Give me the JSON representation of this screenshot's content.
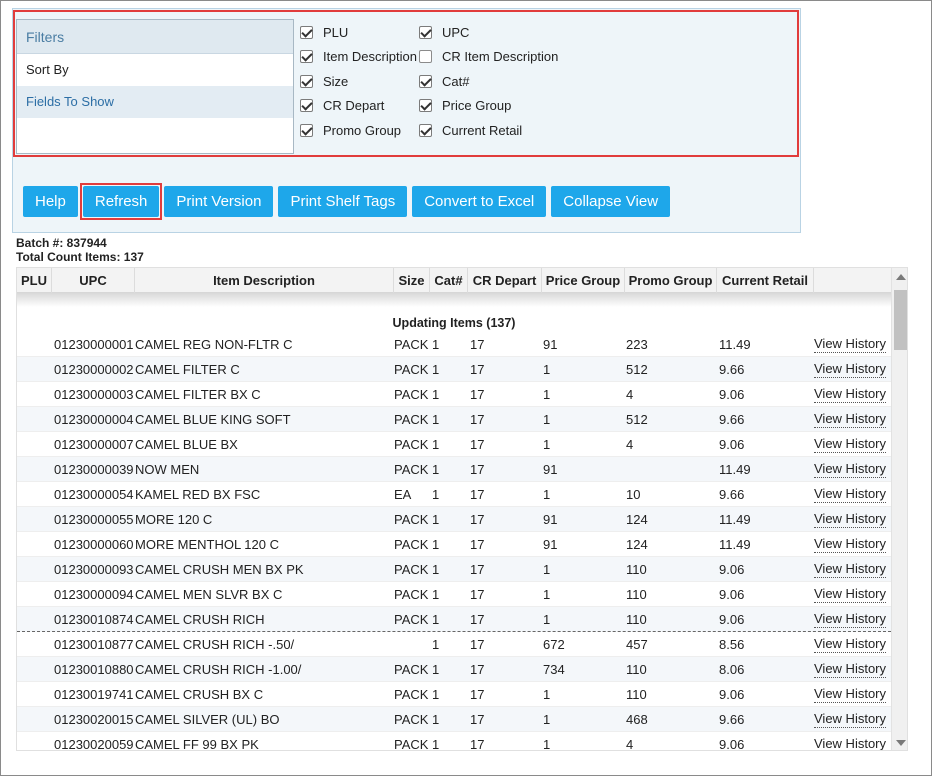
{
  "filters": {
    "items": [
      {
        "label": "Filters"
      },
      {
        "label": "Sort By"
      },
      {
        "label": "Fields To Show"
      }
    ]
  },
  "fields": {
    "left": [
      {
        "label": "PLU",
        "checked": true
      },
      {
        "label": "Item Description",
        "checked": true
      },
      {
        "label": "Size",
        "checked": true
      },
      {
        "label": "CR Depart",
        "checked": true
      },
      {
        "label": "Promo Group",
        "checked": true
      }
    ],
    "right": [
      {
        "label": "UPC",
        "checked": true
      },
      {
        "label": "CR Item Description",
        "checked": false
      },
      {
        "label": "Cat#",
        "checked": true
      },
      {
        "label": "Price Group",
        "checked": true
      },
      {
        "label": "Current Retail",
        "checked": true
      }
    ]
  },
  "buttons": {
    "help": "Help",
    "refresh": "Refresh",
    "print_version": "Print Version",
    "print_shelf_tags": "Print Shelf Tags",
    "convert_excel": "Convert to Excel",
    "collapse_view": "Collapse View"
  },
  "info": {
    "batch": "Batch #: 837944",
    "total": "Total Count Items: 137"
  },
  "table": {
    "headers": [
      "PLU",
      "UPC",
      "Item Description",
      "Size",
      "Cat#",
      "CR Depart",
      "Price Group",
      "Promo Group",
      "Current Retail"
    ],
    "group_title": "Updating Items (137)",
    "view_history": "View History",
    "rows": [
      {
        "upc": "01230000001",
        "desc": "CAMEL REG NON-FLTR C",
        "size": "PACK",
        "cat": "1",
        "dep": "17",
        "price": "91",
        "promo": "223",
        "retail": "11.49"
      },
      {
        "upc": "01230000002",
        "desc": "CAMEL FILTER C",
        "size": "PACK",
        "cat": "1",
        "dep": "17",
        "price": "1",
        "promo": "512",
        "retail": "9.66"
      },
      {
        "upc": "01230000003",
        "desc": "CAMEL FILTER BX C",
        "size": "PACK",
        "cat": "1",
        "dep": "17",
        "price": "1",
        "promo": "4",
        "retail": "9.06"
      },
      {
        "upc": "01230000004",
        "desc": "CAMEL BLUE KING SOFT",
        "size": "PACK",
        "cat": "1",
        "dep": "17",
        "price": "1",
        "promo": "512",
        "retail": "9.66"
      },
      {
        "upc": "01230000007",
        "desc": "CAMEL BLUE BX",
        "size": "PACK",
        "cat": "1",
        "dep": "17",
        "price": "1",
        "promo": "4",
        "retail": "9.06"
      },
      {
        "upc": "01230000039",
        "desc": "NOW MEN",
        "size": "PACK",
        "cat": "1",
        "dep": "17",
        "price": "91",
        "promo": "",
        "retail": "11.49"
      },
      {
        "upc": "01230000054",
        "desc": "KAMEL RED BX FSC",
        "size": "EA",
        "cat": "1",
        "dep": "17",
        "price": "1",
        "promo": "10",
        "retail": "9.66"
      },
      {
        "upc": "01230000055",
        "desc": "MORE 120 C",
        "size": "PACK",
        "cat": "1",
        "dep": "17",
        "price": "91",
        "promo": "124",
        "retail": "11.49"
      },
      {
        "upc": "01230000060",
        "desc": "MORE MENTHOL 120 C",
        "size": "PACK",
        "cat": "1",
        "dep": "17",
        "price": "91",
        "promo": "124",
        "retail": "11.49"
      },
      {
        "upc": "01230000093",
        "desc": "CAMEL CRUSH MEN BX PK",
        "size": "PACK",
        "cat": "1",
        "dep": "17",
        "price": "1",
        "promo": "110",
        "retail": "9.06"
      },
      {
        "upc": "01230000094",
        "desc": "CAMEL MEN SLVR BX C",
        "size": "PACK",
        "cat": "1",
        "dep": "17",
        "price": "1",
        "promo": "110",
        "retail": "9.06"
      },
      {
        "upc": "01230010874",
        "desc": "CAMEL CRUSH RICH",
        "size": "PACK",
        "cat": "1",
        "dep": "17",
        "price": "1",
        "promo": "110",
        "retail": "9.06"
      },
      {
        "upc": "01230010877",
        "desc": "CAMEL CRUSH RICH -.50/",
        "size": "",
        "cat": "1",
        "dep": "17",
        "price": "672",
        "promo": "457",
        "retail": "8.56"
      },
      {
        "upc": "01230010880",
        "desc": "CAMEL CRUSH RICH -1.00/",
        "size": "PACK",
        "cat": "1",
        "dep": "17",
        "price": "734",
        "promo": "110",
        "retail": "8.06"
      },
      {
        "upc": "01230019741",
        "desc": "CAMEL CRUSH BX C",
        "size": "PACK",
        "cat": "1",
        "dep": "17",
        "price": "1",
        "promo": "110",
        "retail": "9.06"
      },
      {
        "upc": "01230020015",
        "desc": "CAMEL SILVER (UL) BO",
        "size": "PACK",
        "cat": "1",
        "dep": "17",
        "price": "1",
        "promo": "468",
        "retail": "9.66"
      },
      {
        "upc": "01230020059",
        "desc": "CAMEL FF 99 BX PK",
        "size": "PACK",
        "cat": "1",
        "dep": "17",
        "price": "1",
        "promo": "4",
        "retail": "9.06"
      }
    ]
  }
}
